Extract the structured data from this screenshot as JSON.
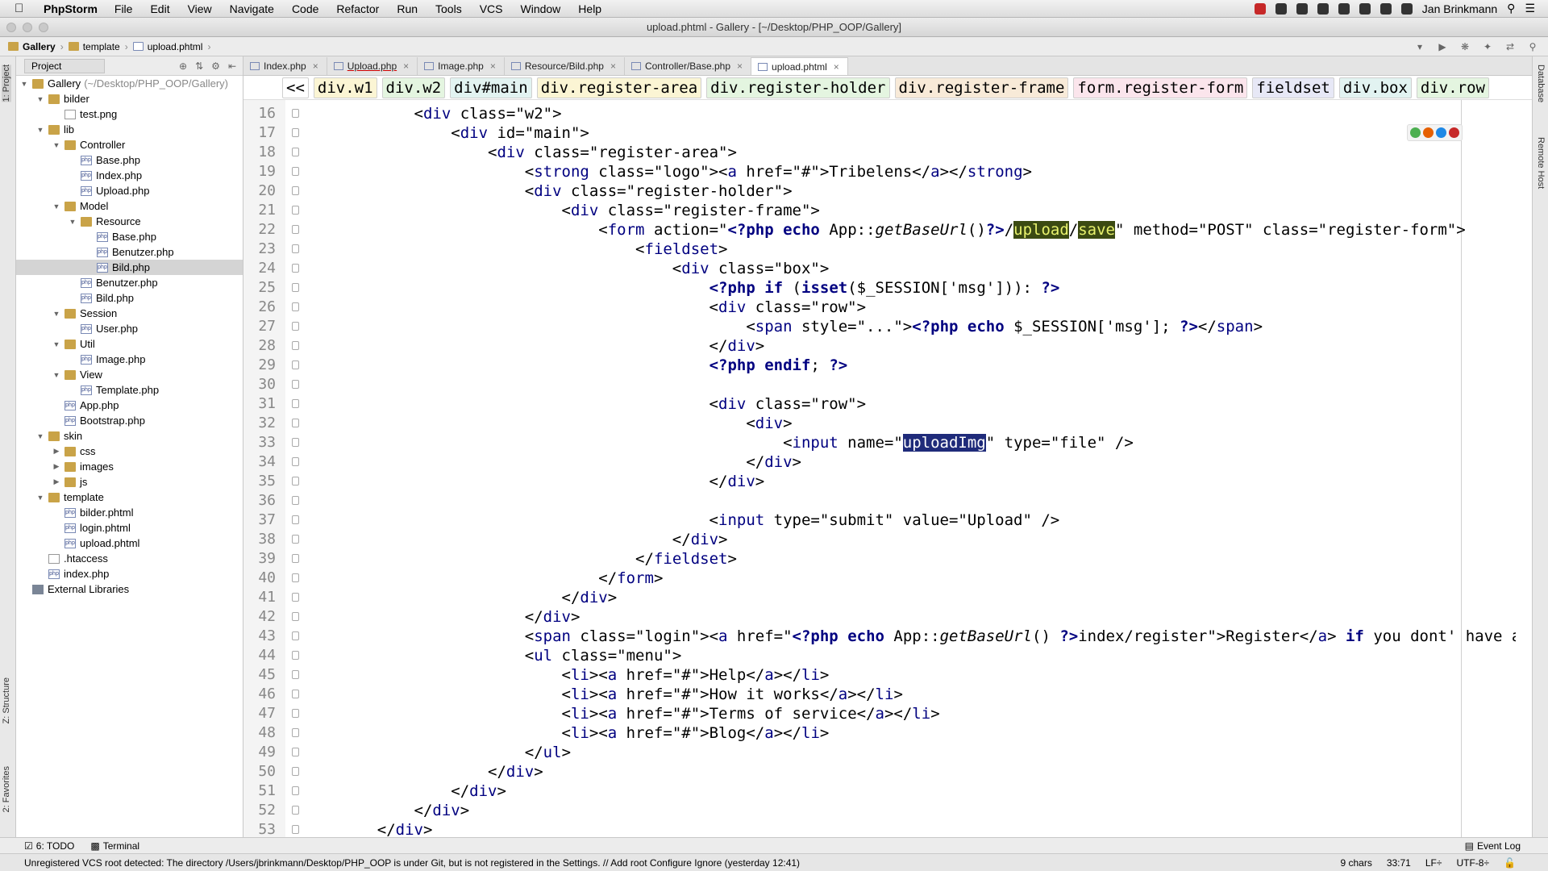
{
  "menubar": {
    "app": "PhpStorm",
    "items": [
      "File",
      "Edit",
      "View",
      "Navigate",
      "Code",
      "Refactor",
      "Run",
      "Tools",
      "VCS",
      "Window",
      "Help"
    ],
    "user": "Jan Brinkmann"
  },
  "window": {
    "title": "upload.phtml - Gallery - [~/Desktop/PHP_OOP/Gallery]"
  },
  "breadcrumbs": [
    "Gallery",
    "template",
    "upload.phtml"
  ],
  "project_panel": {
    "selector": "Project",
    "tree": [
      {
        "label": "Gallery",
        "path": "(~/Desktop/PHP_OOP/Gallery)",
        "depth": 0,
        "type": "folder",
        "expanded": true
      },
      {
        "label": "bilder",
        "depth": 1,
        "type": "folder",
        "expanded": true
      },
      {
        "label": "test.png",
        "depth": 2,
        "type": "file"
      },
      {
        "label": "lib",
        "depth": 1,
        "type": "folder",
        "expanded": true
      },
      {
        "label": "Controller",
        "depth": 2,
        "type": "folder",
        "expanded": true
      },
      {
        "label": "Base.php",
        "depth": 3,
        "type": "php"
      },
      {
        "label": "Index.php",
        "depth": 3,
        "type": "php"
      },
      {
        "label": "Upload.php",
        "depth": 3,
        "type": "php"
      },
      {
        "label": "Model",
        "depth": 2,
        "type": "folder",
        "expanded": true
      },
      {
        "label": "Resource",
        "depth": 3,
        "type": "folder",
        "expanded": true
      },
      {
        "label": "Base.php",
        "depth": 4,
        "type": "php"
      },
      {
        "label": "Benutzer.php",
        "depth": 4,
        "type": "php"
      },
      {
        "label": "Bild.php",
        "depth": 4,
        "type": "php",
        "selected": true
      },
      {
        "label": "Benutzer.php",
        "depth": 3,
        "type": "php"
      },
      {
        "label": "Bild.php",
        "depth": 3,
        "type": "php"
      },
      {
        "label": "Session",
        "depth": 2,
        "type": "folder",
        "expanded": true
      },
      {
        "label": "User.php",
        "depth": 3,
        "type": "php"
      },
      {
        "label": "Util",
        "depth": 2,
        "type": "folder",
        "expanded": true
      },
      {
        "label": "Image.php",
        "depth": 3,
        "type": "php"
      },
      {
        "label": "View",
        "depth": 2,
        "type": "folder",
        "expanded": true
      },
      {
        "label": "Template.php",
        "depth": 3,
        "type": "php"
      },
      {
        "label": "App.php",
        "depth": 2,
        "type": "php"
      },
      {
        "label": "Bootstrap.php",
        "depth": 2,
        "type": "php"
      },
      {
        "label": "skin",
        "depth": 1,
        "type": "folder",
        "expanded": true
      },
      {
        "label": "css",
        "depth": 2,
        "type": "folder",
        "expanded": false
      },
      {
        "label": "images",
        "depth": 2,
        "type": "folder",
        "expanded": false
      },
      {
        "label": "js",
        "depth": 2,
        "type": "folder",
        "expanded": false
      },
      {
        "label": "template",
        "depth": 1,
        "type": "folder",
        "expanded": true
      },
      {
        "label": "bilder.phtml",
        "depth": 2,
        "type": "php"
      },
      {
        "label": "login.phtml",
        "depth": 2,
        "type": "php"
      },
      {
        "label": "upload.phtml",
        "depth": 2,
        "type": "php"
      },
      {
        "label": ".htaccess",
        "depth": 1,
        "type": "file"
      },
      {
        "label": "index.php",
        "depth": 1,
        "type": "php"
      },
      {
        "label": "External Libraries",
        "depth": 0,
        "type": "lib"
      }
    ]
  },
  "tabs": [
    {
      "label": "Index.php"
    },
    {
      "label": "Upload.php",
      "underline": true
    },
    {
      "label": "Image.php"
    },
    {
      "label": "Resource/Bild.php"
    },
    {
      "label": "Controller/Base.php"
    },
    {
      "label": "upload.phtml",
      "active": true
    }
  ],
  "tag_breadcrumbs": [
    "<<",
    "div.w1",
    "div.w2",
    "div#main",
    "div.register-area",
    "div.register-holder",
    "div.register-frame",
    "form.register-form",
    "fieldset",
    "div.box",
    "div.row"
  ],
  "code_lines": [
    {
      "n": "16",
      "t": "        <div class=\"w2\">"
    },
    {
      "n": "17",
      "t": "            <div id=\"main\">"
    },
    {
      "n": "18",
      "t": "                <div class=\"register-area\">"
    },
    {
      "n": "19",
      "t": "                    <strong class=\"logo\"><a href=\"#\">Tribelens</a></strong>"
    },
    {
      "n": "20",
      "t": "                    <div class=\"register-holder\">"
    },
    {
      "n": "21",
      "t": "                        <div class=\"register-frame\">"
    },
    {
      "n": "22",
      "t": "                            <form action=\"<?php echo App::getBaseUrl()?>/upload/save\" method=\"POST\" class=\"register-form\">"
    },
    {
      "n": "23",
      "t": "                                <fieldset>"
    },
    {
      "n": "24",
      "t": "                                    <div class=\"box\">"
    },
    {
      "n": "25",
      "t": "                                        <?php if (isset($_SESSION['msg'])): ?>"
    },
    {
      "n": "26",
      "t": "                                        <div class=\"row\">"
    },
    {
      "n": "27",
      "t": "                                            <span style=\"...\"><?php echo $_SESSION['msg']; ?></span>"
    },
    {
      "n": "28",
      "t": "                                        </div>"
    },
    {
      "n": "29",
      "t": "                                        <?php endif; ?>"
    },
    {
      "n": "30",
      "t": ""
    },
    {
      "n": "31",
      "t": "                                        <div class=\"row\">"
    },
    {
      "n": "32",
      "t": "                                            <div>"
    },
    {
      "n": "33",
      "t": "                                                <input name=\"uploadImg\" type=\"file\" />"
    },
    {
      "n": "34",
      "t": "                                            </div>"
    },
    {
      "n": "35",
      "t": "                                        </div>"
    },
    {
      "n": "36",
      "t": ""
    },
    {
      "n": "37",
      "t": "                                        <input type=\"submit\" value=\"Upload\" />"
    },
    {
      "n": "38",
      "t": "                                    </div>"
    },
    {
      "n": "39",
      "t": "                                </fieldset>"
    },
    {
      "n": "40",
      "t": "                            </form>"
    },
    {
      "n": "41",
      "t": "                        </div>"
    },
    {
      "n": "42",
      "t": "                    </div>"
    },
    {
      "n": "43",
      "t": "                    <span class=\"login\"><a href=\"<?php echo App::getBaseUrl() ?>index/register\">Register</a> if you dont' have a"
    },
    {
      "n": "44",
      "t": "                    <ul class=\"menu\">"
    },
    {
      "n": "45",
      "t": "                        <li><a href=\"#\">Help</a></li>"
    },
    {
      "n": "46",
      "t": "                        <li><a href=\"#\">How it works</a></li>"
    },
    {
      "n": "47",
      "t": "                        <li><a href=\"#\">Terms of service</a></li>"
    },
    {
      "n": "48",
      "t": "                        <li><a href=\"#\">Blog</a></li>"
    },
    {
      "n": "49",
      "t": "                    </ul>"
    },
    {
      "n": "50",
      "t": "                </div>"
    },
    {
      "n": "51",
      "t": "            </div>"
    },
    {
      "n": "52",
      "t": "        </div>"
    },
    {
      "n": "53",
      "t": "    </div>"
    }
  ],
  "side_labels": {
    "project": "1: Project",
    "structure": "Z: Structure",
    "favorites": "2: Favorites",
    "database": "Database",
    "remote": "Remote Host"
  },
  "bottom": {
    "todo": "6: TODO",
    "terminal": "Terminal",
    "event_log": "Event Log"
  },
  "status": {
    "message": "Unregistered VCS root detected: The directory /Users/jbrinkmann/Desktop/PHP_OOP is under Git, but is not registered in the Settings. // Add root  Configure  Ignore (yesterday 12:41)",
    "chars": "9 chars",
    "position": "33:71",
    "line_sep": "LF÷",
    "encoding": "UTF-8÷"
  },
  "colors": {
    "tag": "#000080",
    "attr": "#0000ff",
    "string": "#008000",
    "highlight": "#e7f0c8"
  }
}
